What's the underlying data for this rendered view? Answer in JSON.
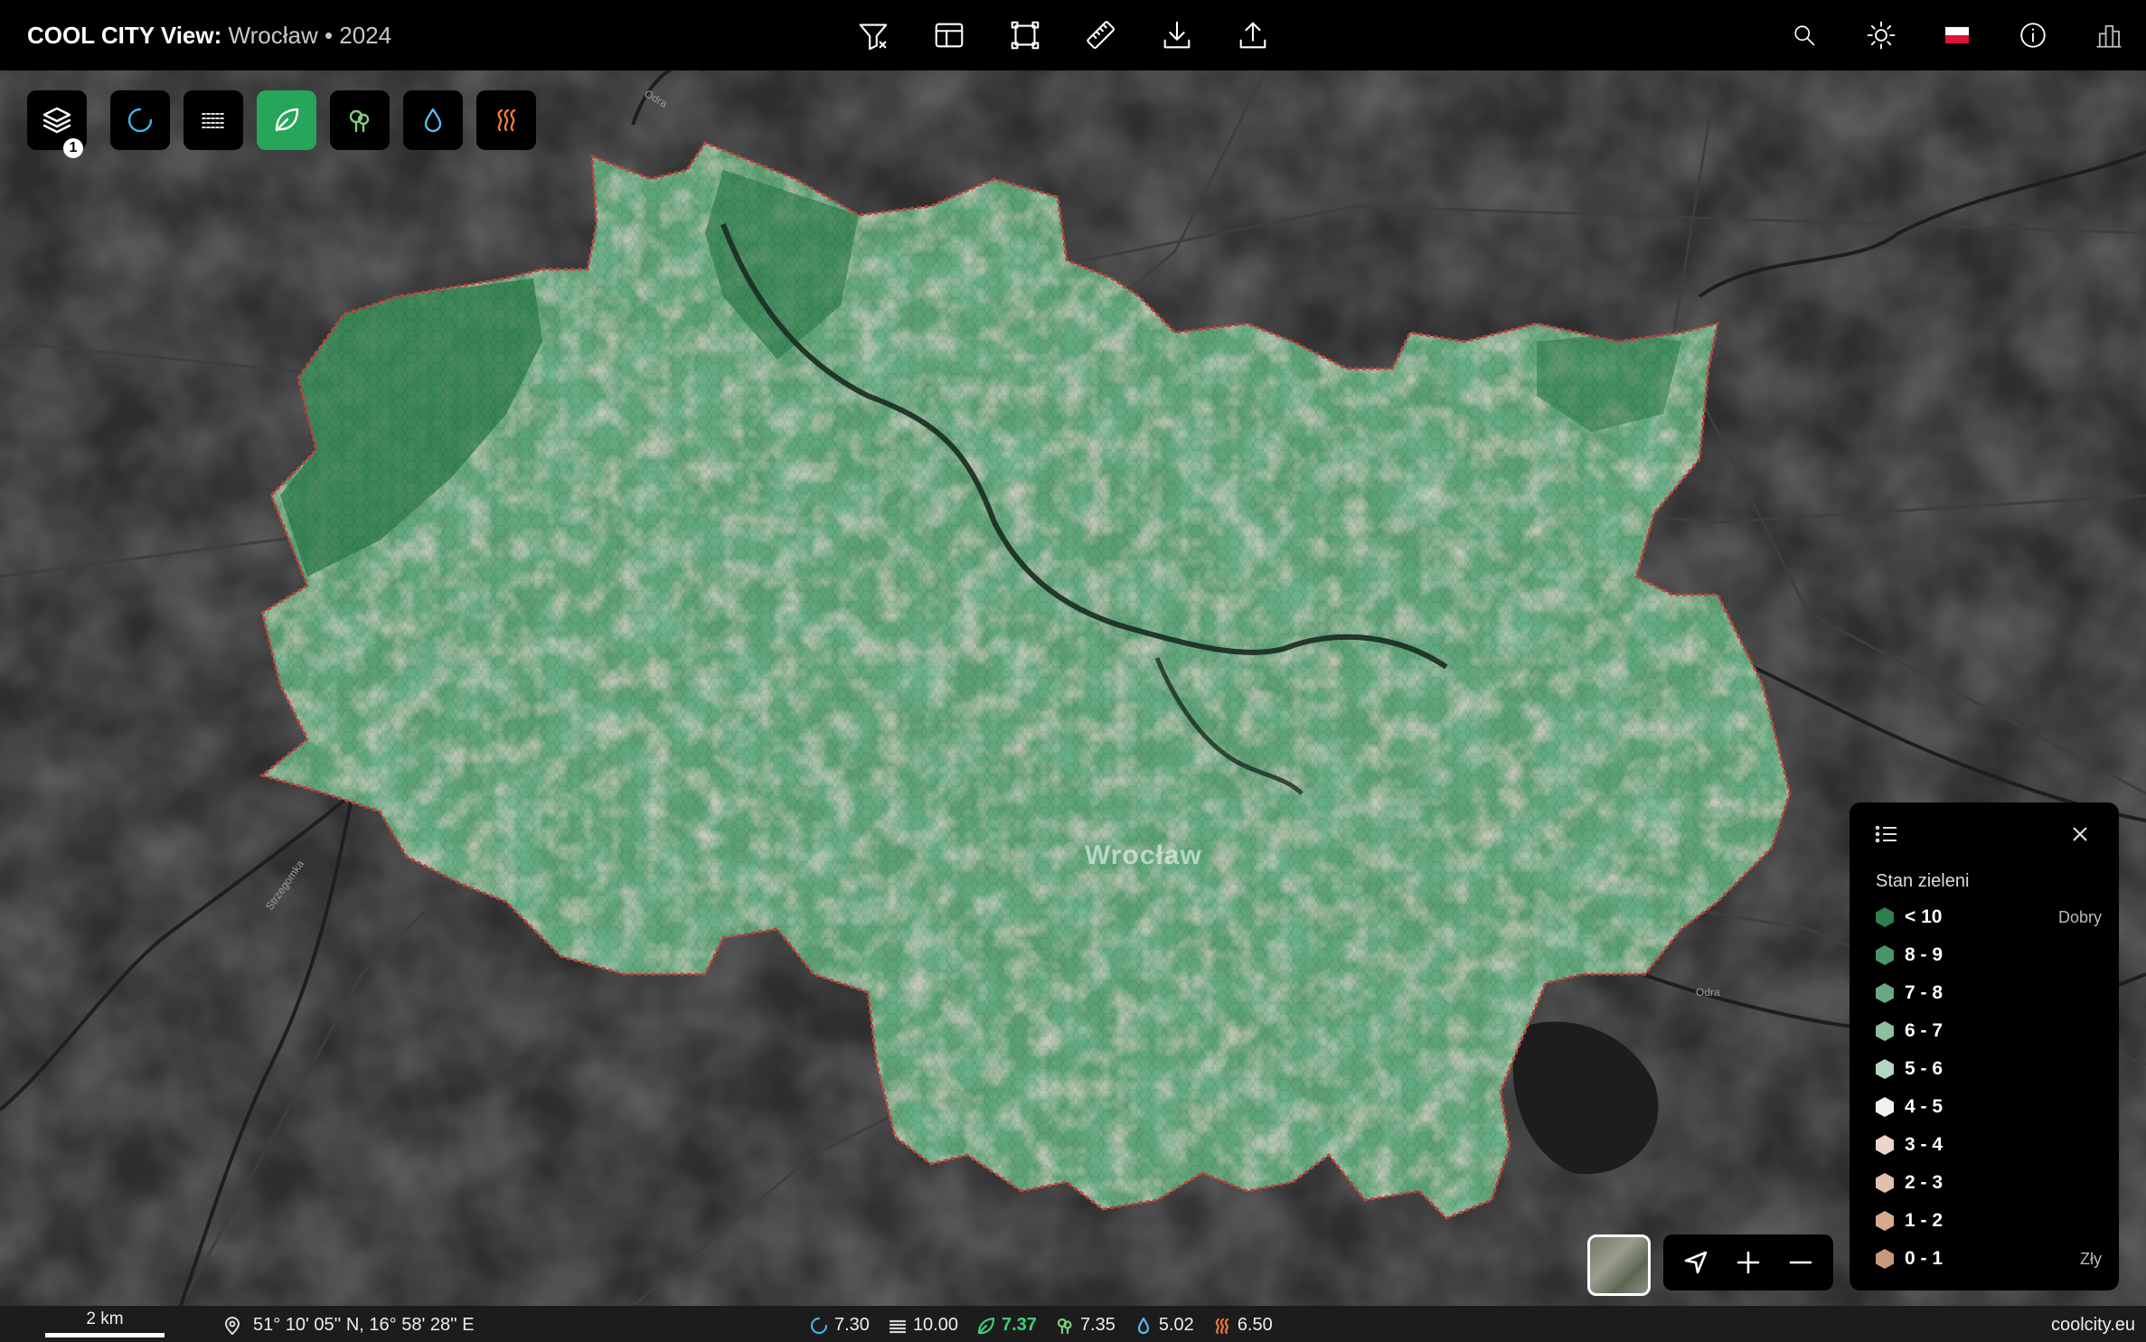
{
  "header": {
    "brand": "COOL CITY View:",
    "city_year": "Wrocław • 2024",
    "toolbar_icons": [
      "filter-icon",
      "table-layout-icon",
      "bounding-box-icon",
      "ruler-icon",
      "download-icon",
      "upload-icon"
    ],
    "right_icons": [
      "search-icon",
      "sun-icon",
      "flag-poland-icon",
      "info-icon",
      "city-icon"
    ]
  },
  "layers": {
    "badge": "1",
    "buttons": [
      "layers-icon",
      "cooling-index-icon",
      "heat-waves-icon",
      "leaf-icon",
      "trees-icon",
      "water-drop-icon",
      "heat-icon"
    ],
    "active": "leaf-icon"
  },
  "map": {
    "city_label": "Wrocław",
    "river_labels": [
      "Odra",
      "Odra",
      "Strzegomka"
    ]
  },
  "legend": {
    "title": "Stan zieleni",
    "rows": [
      {
        "label": "< 10",
        "color": "#2d7f4c",
        "quality": "Dobry"
      },
      {
        "label": "8 - 9",
        "color": "#4a9467",
        "quality": ""
      },
      {
        "label": "7 - 8",
        "color": "#6aa883",
        "quality": ""
      },
      {
        "label": "6 - 7",
        "color": "#8dbea1",
        "quality": ""
      },
      {
        "label": "5 - 6",
        "color": "#b3d6c0",
        "quality": ""
      },
      {
        "label": "4 - 5",
        "color": "#f3f1ec",
        "quality": ""
      },
      {
        "label": "3 - 4",
        "color": "#ecd6c9",
        "quality": ""
      },
      {
        "label": "2 - 3",
        "color": "#e2c0ad",
        "quality": ""
      },
      {
        "label": "1 - 2",
        "color": "#d7a98d",
        "quality": ""
      },
      {
        "label": "0 - 1",
        "color": "#c8987a",
        "quality": "Zły"
      }
    ]
  },
  "status": {
    "scale": "2 km",
    "coordinates": "51° 10' 05'' N, 16° 58' 28'' E",
    "metrics": [
      {
        "icon": "cooling-index-icon",
        "value": "7.30",
        "color": "#3bb6e8"
      },
      {
        "icon": "heat-waves-icon",
        "value": "10.00",
        "color": "#d8d8d8"
      },
      {
        "icon": "leaf-icon",
        "value": "7.37",
        "color": "#3fd07a"
      },
      {
        "icon": "trees-icon",
        "value": "7.35",
        "color": "#7fd07a"
      },
      {
        "icon": "water-drop-icon",
        "value": "5.02",
        "color": "#5fb6f0"
      },
      {
        "icon": "heat-icon",
        "value": "6.50",
        "color": "#f07a3a"
      }
    ],
    "site": "coolcity.eu"
  }
}
